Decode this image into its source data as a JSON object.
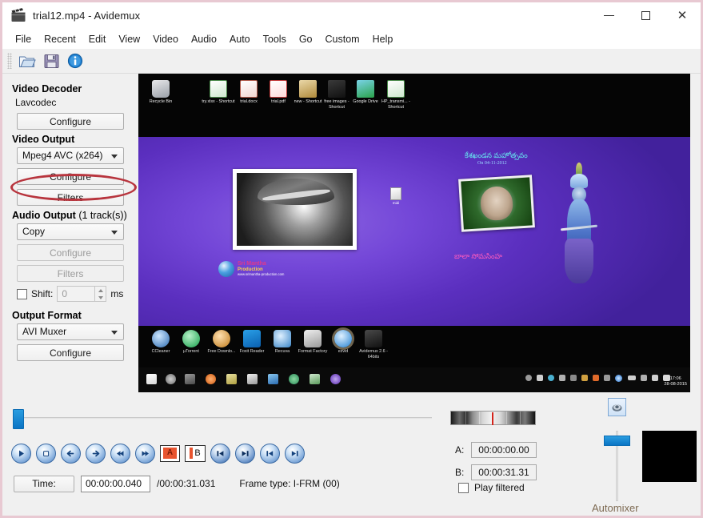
{
  "window": {
    "title": "trial12.mp4 - Avidemux",
    "icon": "film-clapper-icon",
    "minimize_label": "Minimize",
    "maximize_label": "Maximize",
    "close_label": "Close"
  },
  "menubar": {
    "items": [
      {
        "label": "File"
      },
      {
        "label": "Recent"
      },
      {
        "label": "Edit"
      },
      {
        "label": "View"
      },
      {
        "label": "Video"
      },
      {
        "label": "Audio"
      },
      {
        "label": "Auto"
      },
      {
        "label": "Tools"
      },
      {
        "label": "Go"
      },
      {
        "label": "Custom"
      },
      {
        "label": "Help"
      }
    ]
  },
  "toolbar": {
    "buttons": [
      {
        "name": "open-file-icon",
        "title": "Open"
      },
      {
        "name": "save-file-icon",
        "title": "Save"
      },
      {
        "name": "info-icon",
        "title": "Properties"
      }
    ]
  },
  "left_panel": {
    "video_decoder": {
      "section_title": "Video Decoder",
      "codec_name": "Lavcodec",
      "configure_label": "Configure"
    },
    "video_output": {
      "section_title": "Video Output",
      "selected_codec": "Mpeg4 AVC (x264)",
      "configure_label": "Configure",
      "filters_label": "Filters",
      "highlighted": "configure"
    },
    "audio_output": {
      "section_title": "Audio Output",
      "section_subtitle": "(1 track(s))",
      "selected_mode": "Copy",
      "configure_label": "Configure",
      "filters_label": "Filters",
      "shift_label": "Shift:",
      "shift_value": "0",
      "shift_units": "ms",
      "shift_enabled": false
    },
    "output_format": {
      "section_title": "Output Format",
      "selected_muxer": "AVI Muxer",
      "configure_label": "Configure"
    }
  },
  "preview": {
    "desktop_icons": [
      {
        "label": "Recycle Bin",
        "icon": "recycle-bin-icon"
      },
      {
        "label": "try.xlsx - Shortcut",
        "icon": "excel-file-icon"
      },
      {
        "label": "trial.docx",
        "icon": "word-file-icon"
      },
      {
        "label": "trial.pdf",
        "icon": "pdf-file-icon"
      },
      {
        "label": "new - Shortcut",
        "icon": "folder-shortcut-icon"
      },
      {
        "label": "free images - Shortcut",
        "icon": "music-note-icon"
      },
      {
        "label": "Google Drive",
        "icon": "google-drive-icon"
      },
      {
        "label": "HP_transmi... - Shortcut",
        "icon": "excel-file-icon"
      }
    ],
    "tray_apps": [
      {
        "label": "CCleaner",
        "icon": "ccleaner-icon"
      },
      {
        "label": "µTorrent",
        "icon": "utorrent-icon"
      },
      {
        "label": "Free Downlo...",
        "icon": "free-download-manager-icon"
      },
      {
        "label": "Foxit Reader",
        "icon": "foxit-reader-icon"
      },
      {
        "label": "Recuva",
        "icon": "recuva-icon"
      },
      {
        "label": "Format Factory",
        "icon": "format-factory-icon"
      },
      {
        "label": "ezvid",
        "icon": "ezvid-icon"
      },
      {
        "label": "Avidemux 2.6 - 64bits",
        "icon": "avidemux-icon"
      }
    ],
    "overlay_text": {
      "title_line": "కేశఖండన మహోత్సవం",
      "date_line": "On 04-11-2012",
      "caption_line": "బాలా సోమసింహ"
    },
    "branding": {
      "line1": "Sri Mantha",
      "line2": "Production",
      "line3": "www.srimantha-production.com"
    },
    "file_icon_label": "midi",
    "clock": {
      "time": "17:06",
      "date": "28-08-2015"
    }
  },
  "transport": {
    "buttons": [
      {
        "name": "play-button",
        "label": "Play"
      },
      {
        "name": "stop-button",
        "label": "Stop"
      },
      {
        "name": "previous-button",
        "label": "Previous"
      },
      {
        "name": "next-button",
        "label": "Next"
      },
      {
        "name": "rewind-button",
        "label": "Rewind"
      },
      {
        "name": "forward-button",
        "label": "Forward"
      },
      {
        "name": "marker-a-button",
        "label": "A"
      },
      {
        "name": "marker-b-button",
        "label": "B"
      },
      {
        "name": "previous-keyframe-button",
        "label": "Previous keyframe"
      },
      {
        "name": "next-keyframe-button",
        "label": "Next keyframe"
      },
      {
        "name": "first-frame-button",
        "label": "First frame"
      },
      {
        "name": "last-frame-button",
        "label": "Last frame"
      }
    ]
  },
  "status": {
    "time_button_label": "Time:",
    "time_value": "00:00:00.040",
    "time_total": "/00:00:31.031",
    "frame_type_label": "Frame type:",
    "frame_type_value": "I-FRM (00)"
  },
  "selection": {
    "a_label": "A:",
    "a_value": "00:00:00.00",
    "b_label": "B:",
    "b_value": "00:00:31.31",
    "play_filtered_label": "Play filtered",
    "play_filtered_checked": false
  },
  "right_controls": {
    "volume_icon": "speaker-icon",
    "volume_percent": 88,
    "thumbnail_label": "Preview thumbnail"
  },
  "background_app": {
    "visible_text": "Automixer"
  },
  "colors": {
    "accent_blue": "#0a74c4",
    "highlight_red": "#b8353e",
    "marker_orange": "#e8542f",
    "panel_bg": "#f0f0f0",
    "window_border": "#e8c9d2",
    "desktop_purple": "#5b2fbf"
  }
}
